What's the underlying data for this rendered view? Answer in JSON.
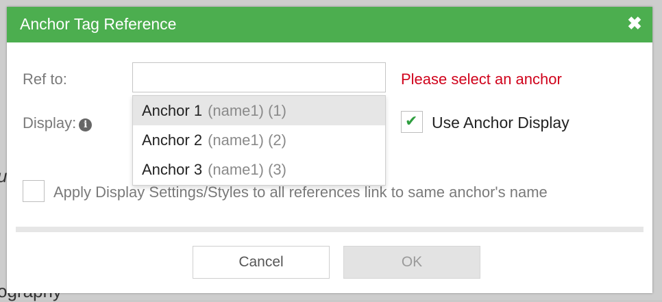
{
  "background": {
    "text_fragment_1": "u",
    "text_fragment_2": "ography"
  },
  "dialog": {
    "title": "Anchor Tag Reference",
    "close_icon": "close-icon",
    "ref_label": "Ref to:",
    "ref_input_value": "",
    "ref_error": "Please select an anchor",
    "display_label": "Display:",
    "display_info_icon": "info-icon",
    "dropdown_items": [
      {
        "label": "Anchor 1",
        "meta": "(name1) (1)",
        "highlighted": true
      },
      {
        "label": "Anchor 2",
        "meta": "(name1) (2)",
        "highlighted": false
      },
      {
        "label": "Anchor 3",
        "meta": "(name1) (3)",
        "highlighted": false
      }
    ],
    "use_anchor_display": {
      "label": "Use Anchor Display",
      "checked": true
    },
    "apply_display_settings": {
      "label": "Apply Display Settings/Styles to all references link to same anchor's name",
      "checked": false
    },
    "cancel_label": "Cancel",
    "ok_label": "OK"
  },
  "colors": {
    "title_bar": "#4cae4f",
    "error": "#d0021b",
    "check": "#2e9e3f"
  }
}
